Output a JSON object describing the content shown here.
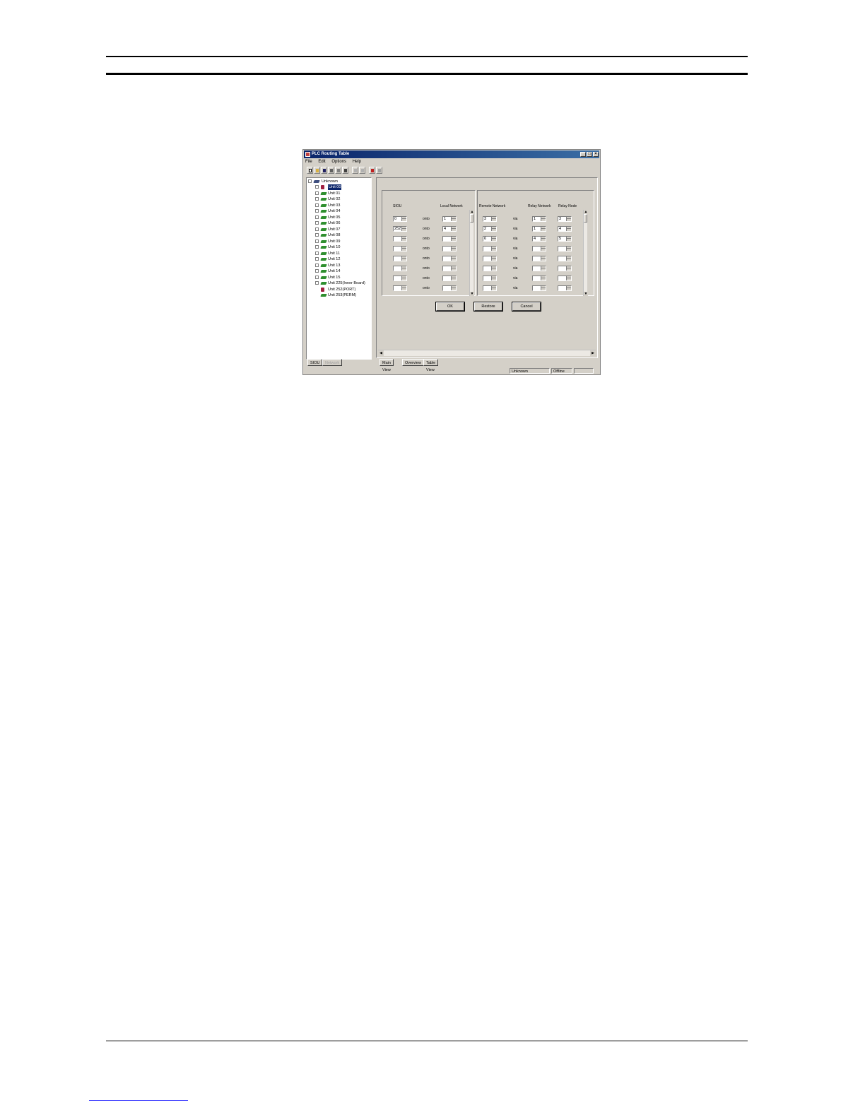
{
  "window": {
    "title": "PLC Routing Table",
    "min_btn": "_",
    "max_btn": "□",
    "close_btn": "×"
  },
  "menu": [
    "File",
    "Edit",
    "Options",
    "Help"
  ],
  "tree": {
    "root": "Unknown",
    "units": [
      "Unit 00",
      "Unit 01",
      "Unit 02",
      "Unit 03",
      "Unit 04",
      "Unit 05",
      "Unit 06",
      "Unit 07",
      "Unit 08",
      "Unit 09",
      "Unit 10",
      "Unit 11",
      "Unit 12",
      "Unit 13",
      "Unit 14",
      "Unit 15",
      "Unit 225(Inner Board)",
      "Unit 252(PORT)",
      "Unit 253(PERM)"
    ]
  },
  "left_tabs": [
    "SIOU",
    "Network"
  ],
  "table": {
    "left_headers": {
      "siou": "SIOU",
      "local_network": "Local Network"
    },
    "right_headers": {
      "remote_network": "Remote Network",
      "relay_network": "Relay Network",
      "relay_node": "Relay Node"
    },
    "onto_word": "onto",
    "via_word": "via",
    "left_rows": [
      {
        "siou": "0",
        "local": "1"
      },
      {
        "siou": "252",
        "local": "4"
      },
      {
        "siou": "",
        "local": ""
      },
      {
        "siou": "",
        "local": ""
      },
      {
        "siou": "",
        "local": ""
      },
      {
        "siou": "",
        "local": ""
      },
      {
        "siou": "",
        "local": ""
      },
      {
        "siou": "",
        "local": ""
      }
    ],
    "right_rows": [
      {
        "remote": "3",
        "relay_net": "1",
        "relay_node": "3"
      },
      {
        "remote": "2",
        "relay_net": "1",
        "relay_node": "4"
      },
      {
        "remote": "6",
        "relay_net": "4",
        "relay_node": "5"
      },
      {
        "remote": "",
        "relay_net": "",
        "relay_node": ""
      },
      {
        "remote": "",
        "relay_net": "",
        "relay_node": ""
      },
      {
        "remote": "",
        "relay_net": "",
        "relay_node": ""
      },
      {
        "remote": "",
        "relay_net": "",
        "relay_node": ""
      },
      {
        "remote": "",
        "relay_net": "",
        "relay_node": ""
      }
    ]
  },
  "buttons": {
    "ok": "OK",
    "restore": "Restore",
    "cancel": "Cancel"
  },
  "view_tabs": [
    "Main View",
    "Overview",
    "Table View"
  ],
  "status": {
    "cell1": "Unknown",
    "cell2": "Offline"
  }
}
